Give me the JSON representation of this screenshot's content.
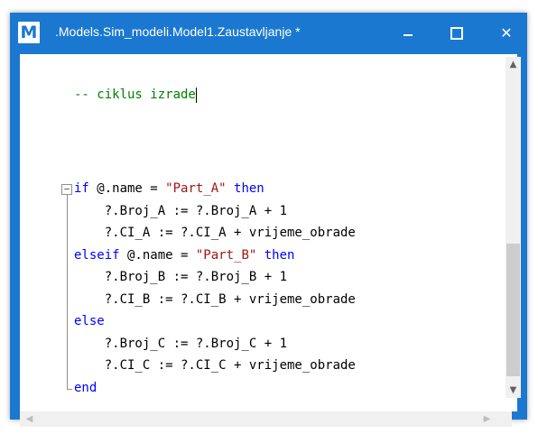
{
  "window": {
    "title": ".Models.Sim_modeli.Model1.Zaustavljanje *",
    "icon_letter": "M",
    "icon": "app-icon-m",
    "accent": "#1b78d0"
  },
  "controls": {
    "minimize_icon": "minimize-icon",
    "maximize_icon": "maximize-icon",
    "close_icon": "close-icon"
  },
  "code": {
    "comment": "-- ciklus izrade",
    "if_kw": "if",
    "if_cond_pre": " @.name = ",
    "if_str": "\"Part_A\"",
    "then_kw": " then",
    "l_broj_a": "    ?.Broj_A := ?.Broj_A + 1",
    "l_ci_a": "    ?.CI_A := ?.CI_A + vrijeme_obrade",
    "elseif_kw": "elseif",
    "elseif_cond_pre": " @.name = ",
    "elseif_str": "\"Part_B\"",
    "then2_kw": " then",
    "l_broj_b": "    ?.Broj_B := ?.Broj_B + 1",
    "l_ci_b": "    ?.CI_B := ?.CI_B + vrijeme_obrade",
    "else_kw": "else",
    "l_broj_c": "    ?.Broj_C := ?.Broj_C + 1",
    "l_ci_c": "    ?.CI_C := ?.CI_C + vrijeme_obrade",
    "end_kw": "end"
  },
  "colors": {
    "keyword": "#0000ff",
    "string": "#a31515",
    "comment": "#008000"
  }
}
